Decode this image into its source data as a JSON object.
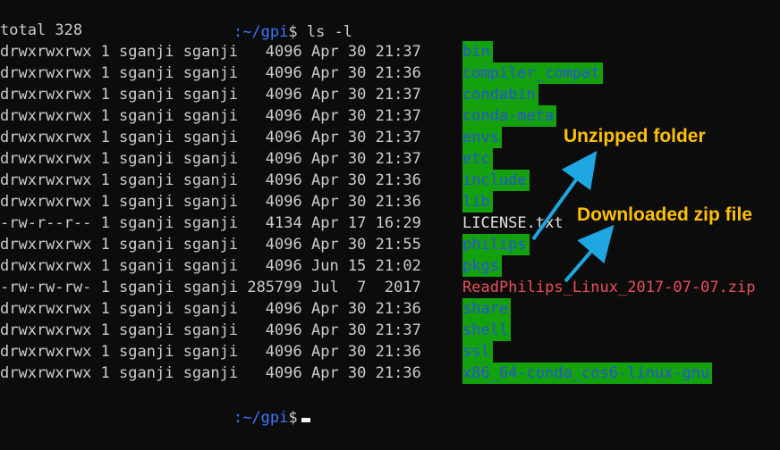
{
  "prompt_top": {
    "path": ":~/gpi",
    "symbol": "$",
    "command": " ls -l"
  },
  "total": "total 328",
  "entries": [
    {
      "meta": "drwxrwxrwx 1 sganji sganji   4096 Apr 30 21:37",
      "name": "bin",
      "kind": "dir"
    },
    {
      "meta": "drwxrwxrwx 1 sganji sganji   4096 Apr 30 21:36",
      "name": "compiler_compat",
      "kind": "dir"
    },
    {
      "meta": "drwxrwxrwx 1 sganji sganji   4096 Apr 30 21:37",
      "name": "condabin",
      "kind": "dir"
    },
    {
      "meta": "drwxrwxrwx 1 sganji sganji   4096 Apr 30 21:37",
      "name": "conda-meta",
      "kind": "dir"
    },
    {
      "meta": "drwxrwxrwx 1 sganji sganji   4096 Apr 30 21:37",
      "name": "envs",
      "kind": "dir"
    },
    {
      "meta": "drwxrwxrwx 1 sganji sganji   4096 Apr 30 21:37",
      "name": "etc",
      "kind": "dir"
    },
    {
      "meta": "drwxrwxrwx 1 sganji sganji   4096 Apr 30 21:36",
      "name": "include",
      "kind": "dir"
    },
    {
      "meta": "drwxrwxrwx 1 sganji sganji   4096 Apr 30 21:36",
      "name": "lib",
      "kind": "dir"
    },
    {
      "meta": "-rw-r--r-- 1 sganji sganji   4134 Apr 17 16:29",
      "name": "LICENSE.txt",
      "kind": "file"
    },
    {
      "meta": "drwxrwxrwx 1 sganji sganji   4096 Apr 30 21:55",
      "name": "philips",
      "kind": "dir"
    },
    {
      "meta": "drwxrwxrwx 1 sganji sganji   4096 Jun 15 21:02",
      "name": "pkgs",
      "kind": "dir"
    },
    {
      "meta": "-rw-rw-rw- 1 sganji sganji 285799 Jul  7  2017",
      "name": "ReadPhilips_Linux_2017-07-07.zip",
      "kind": "zip"
    },
    {
      "meta": "drwxrwxrwx 1 sganji sganji   4096 Apr 30 21:36",
      "name": "share",
      "kind": "dir"
    },
    {
      "meta": "drwxrwxrwx 1 sganji sganji   4096 Apr 30 21:37",
      "name": "shell",
      "kind": "dir"
    },
    {
      "meta": "drwxrwxrwx 1 sganji sganji   4096 Apr 30 21:36",
      "name": "ssl",
      "kind": "dir"
    },
    {
      "meta": "drwxrwxrwx 1 sganji sganji   4096 Apr 30 21:36",
      "name": "x86_64-conda_cos6-linux-gnu",
      "kind": "dir"
    }
  ],
  "prompt_bottom": {
    "path": ":~/gpi",
    "symbol": "$"
  },
  "annotations": {
    "unzipped": "Unzipped folder",
    "downloaded": "Downloaded zip file"
  },
  "colors": {
    "background": "#0c0c0c",
    "text": "#cccccc",
    "dir_highlight": "#13a10e",
    "dir_text": "#2b52d9",
    "zip_text": "#e8505b",
    "annotation": "#ffc000",
    "arrow": "#1ea7e1"
  }
}
